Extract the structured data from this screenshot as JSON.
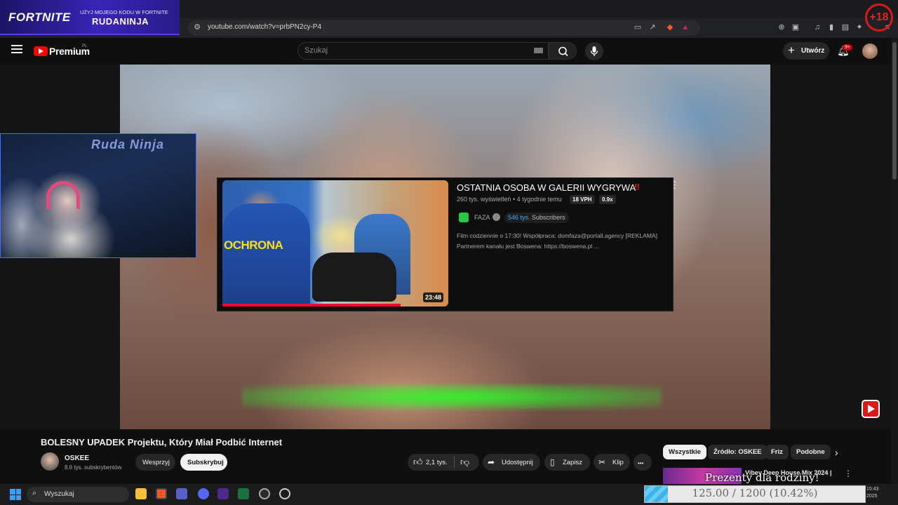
{
  "browser": {
    "url": "youtube.com/watch?v=prbPN2cy-P4"
  },
  "fortnite_banner": {
    "logo": "FORTNITE",
    "line1": "UŻYJ MOJEGO KODU W FORTNITE",
    "code": "RUDANINJA"
  },
  "age_badge": "+18",
  "youtube": {
    "logo_text": "Premium",
    "region": "PL",
    "search_placeholder": "Szukaj",
    "create_label": "Utwórz",
    "notification_count": "9+"
  },
  "webcam": {
    "neon_sign": "Ruda Ninja"
  },
  "popup": {
    "title": "OSTATNIA OSOBA W GALERII WYGRYWA",
    "alert": "‼",
    "views": "260 tys. wyświetleń • 4 tygodnie temu",
    "vph": "18 VPH",
    "ratio": "0.9x",
    "channel": "FAZA",
    "subs_count": "546 tys.",
    "subs_label": "Subscribers",
    "desc_line1": "Film codziennie o 17:30! Współpraca: domfaza@portall.agency [REKLAMA]",
    "desc_line2": "Partnerem kanału jest Boswena: https://boswena.pl ...",
    "thumb_text": "OCHRONA",
    "duration": "23:48",
    "watched_fraction": 0.79
  },
  "video": {
    "title": "BOLESNY UPADEK Projektu, Który Miał Podbić Internet",
    "channel": "OSKEE",
    "subscribers": "8,6 tys. subskrybentów",
    "join_label": "Wesprzyj",
    "subscribe_label": "Subskrybuj",
    "likes": "2,1 tys.",
    "share_label": "Udostępnij",
    "save_label": "Zapisz",
    "clip_label": "Klip",
    "more_label": "•••"
  },
  "filter_chips": [
    "Wszystkie",
    "Źródło: OSKEE",
    "Friz",
    "Podobne"
  ],
  "recommendation": {
    "title": "Vibey Deep House Mix 2024 |",
    "overlay": "Prezenty dla rodziny!"
  },
  "taskbar": {
    "search_placeholder": "Wyszukaj",
    "time": "15:43",
    "date": "2025"
  },
  "goal_bar": {
    "text": "125.00 / 1200 (10.42%)",
    "fraction": 0.1042
  },
  "colors": {
    "youtube_red": "#ff0000",
    "banner_purple": "#3a24b8",
    "subs_blue": "#3ea6ff",
    "progress_blue": "#3cb4e8"
  },
  "icons": [
    "menu-icon",
    "search-icon",
    "mic-icon",
    "bell-icon",
    "windows-icon",
    "folder-icon",
    "brave-icon",
    "teams-icon",
    "discord-icon",
    "excel-icon",
    "obs-icon"
  ]
}
